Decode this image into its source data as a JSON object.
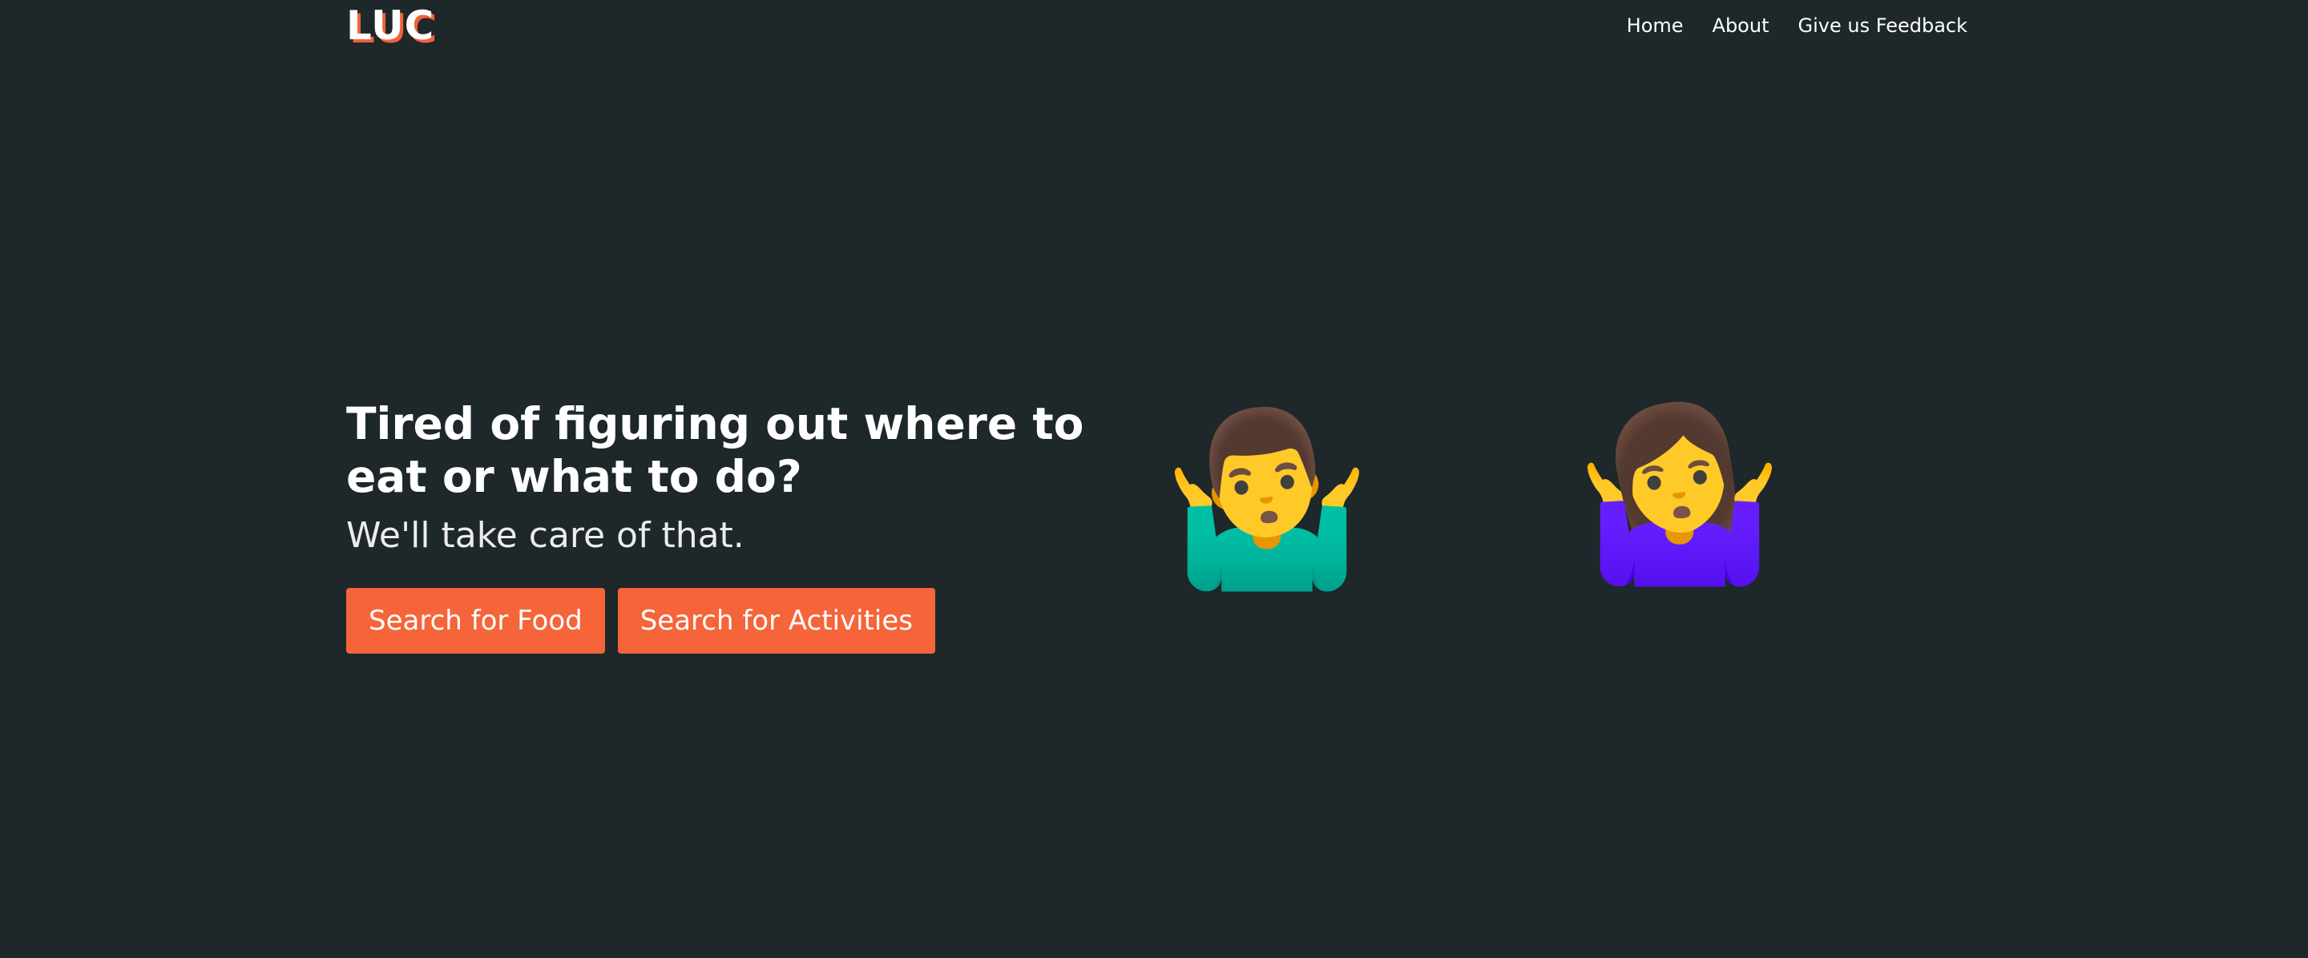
{
  "brand": {
    "logo_text": "LUC",
    "accent_color": "#f66439",
    "background_color": "#1e2729"
  },
  "nav": {
    "items": [
      {
        "label": "Home"
      },
      {
        "label": "About"
      },
      {
        "label": "Give us Feedback"
      }
    ]
  },
  "hero": {
    "headline": "Tired of figuring out where to eat or what to do?",
    "subheadline": "We'll take care of that.",
    "buttons": {
      "food": "Search for Food",
      "activities": "Search for Activities"
    },
    "illustrations": {
      "man": {
        "glyph": "🤷‍♂️",
        "icon": "man-shrugging-icon"
      },
      "woman": {
        "glyph": "🤷‍♀️",
        "icon": "woman-shrugging-icon"
      }
    }
  }
}
